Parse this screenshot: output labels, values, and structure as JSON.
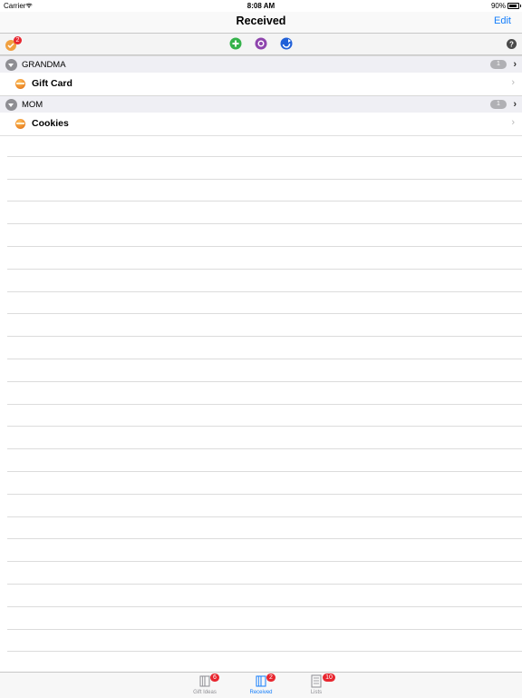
{
  "status_bar": {
    "carrier": "Carrier",
    "time": "8:08 AM",
    "battery": "90%"
  },
  "navbar": {
    "title": "Received",
    "edit_label": "Edit"
  },
  "toolbar": {
    "app_badge": "2"
  },
  "sections": [
    {
      "name": "GRANDMA",
      "count": "1",
      "items": [
        {
          "label": "Gift Card"
        }
      ]
    },
    {
      "name": "MOM",
      "count": "1",
      "items": [
        {
          "label": "Cookies"
        }
      ]
    }
  ],
  "tabbar": {
    "tabs": [
      {
        "label": "Gift Ideas",
        "badge": "6",
        "active": false
      },
      {
        "label": "Received",
        "badge": "2",
        "active": true
      },
      {
        "label": "Lists",
        "badge": "10",
        "active": false
      }
    ]
  },
  "colors": {
    "accent": "#147efb",
    "badge": "#e8262f",
    "add": "#4cd964",
    "purple": "#8e44ad",
    "blue": "#2060d8"
  },
  "icons": [
    "wifi-icon",
    "app-gift-icon",
    "add-icon",
    "target-icon",
    "refresh-icon",
    "help-icon",
    "chevron-right-icon",
    "gift-icon"
  ]
}
